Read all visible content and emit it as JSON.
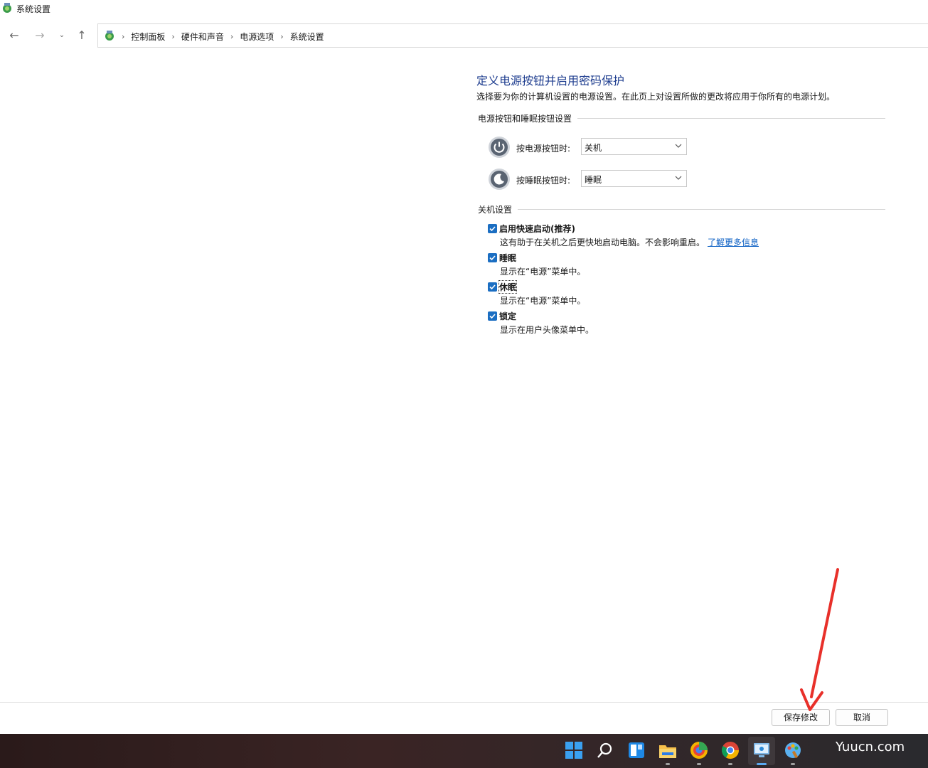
{
  "window": {
    "title": "系统设置"
  },
  "nav": {
    "breadcrumbs": [
      "控制面板",
      "硬件和声音",
      "电源选项",
      "系统设置"
    ]
  },
  "page": {
    "title": "定义电源按钮并启用密码保护",
    "description": "选择要为你的计算机设置的电源设置。在此页上对设置所做的更改将应用于你所有的电源计划。"
  },
  "power_section": {
    "header": "电源按钮和睡眠按钮设置",
    "power_button": {
      "label": "按电源按钮时:",
      "value": "关机"
    },
    "sleep_button": {
      "label": "按睡眠按钮时:",
      "value": "睡眠"
    }
  },
  "shutdown_section": {
    "header": "关机设置",
    "items": [
      {
        "label": "启用快速启动(推荐)",
        "desc": "这有助于在关机之后更快地启动电脑。不会影响重启。",
        "link": "了解更多信息",
        "checked": true
      },
      {
        "label": "睡眠",
        "desc": "显示在“电源”菜单中。",
        "checked": true
      },
      {
        "label": "休眠",
        "desc": "显示在“电源”菜单中。",
        "checked": true
      },
      {
        "label": "锁定",
        "desc": "显示在用户头像菜单中。",
        "checked": true
      }
    ]
  },
  "footer": {
    "save_label": "保存修改",
    "cancel_label": "取消"
  },
  "watermark": "Yuucn.com",
  "colors": {
    "accent": "#1b6ec2",
    "title_blue": "#1e3d8f",
    "link": "#0b5fc4",
    "arrow": "#e8302a"
  }
}
